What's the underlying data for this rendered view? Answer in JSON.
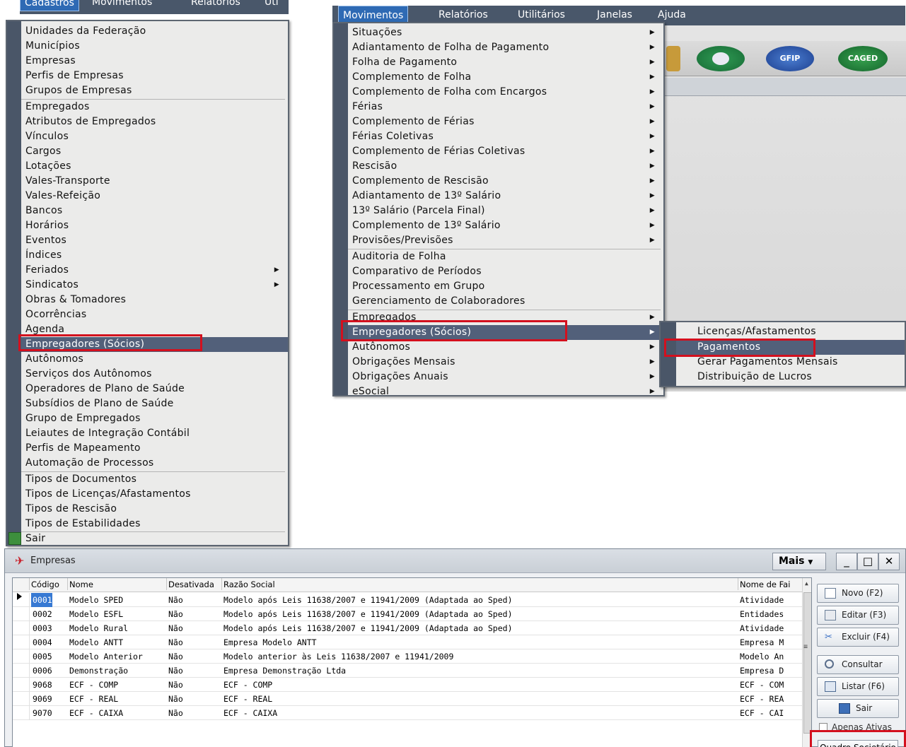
{
  "menubar_left": {
    "items": [
      "Cadastros",
      "Movimentos",
      "Relatórios",
      "Uti"
    ]
  },
  "menubar_right": {
    "items": [
      "Movimentos",
      "Relatórios",
      "Utilitários",
      "Janelas",
      "Ajuda"
    ]
  },
  "menu_cadastros": {
    "items": [
      "Unidades da Federação",
      "Municípios",
      "Empresas",
      "Perfis de Empresas",
      "Grupos de Empresas",
      "Empregados",
      "Atributos de Empregados",
      "Vínculos",
      "Cargos",
      "Lotações",
      "Vales-Transporte",
      "Vales-Refeição",
      "Bancos",
      "Horários",
      "Eventos",
      "Índices",
      "Feriados",
      "Sindicatos",
      "Obras & Tomadores",
      "Ocorrências",
      "Agenda",
      "Empregadores (Sócios)",
      "Autônomos",
      "Serviços dos Autônomos",
      "Operadores de Plano de Saúde",
      "Subsídios de Plano de Saúde",
      "Grupo de Empregados",
      "Leiautes de Integração Contábil",
      "Perfis de Mapeamento",
      "Automação de Processos",
      "Tipos de Documentos",
      "Tipos de Licenças/Afastamentos",
      "Tipos de Rescisão",
      "Tipos de Estabilidades",
      "Sair"
    ]
  },
  "menu_movimentos": {
    "items": [
      "Situações",
      "Adiantamento de Folha de Pagamento",
      "Folha de Pagamento",
      "Complemento de Folha",
      "Complemento de Folha com Encargos",
      "Férias",
      "Complemento de Férias",
      "Férias Coletivas",
      "Complemento de Férias Coletivas",
      "Rescisão",
      "Complemento de Rescisão",
      "Adiantamento de 13º Salário",
      "13º Salário (Parcela Final)",
      "Complemento de 13º Salário",
      "Provisões/Previsões",
      "Auditoria de Folha",
      "Comparativo de Períodos",
      "Processamento em Grupo",
      "Gerenciamento de Colaboradores",
      "Empregados",
      "Empregadores (Sócios)",
      "Autônomos",
      "Obrigações Mensais",
      "Obrigações Anuais",
      "eSocial"
    ]
  },
  "menu_empregadores_sub": {
    "items": [
      "Licenças/Afastamentos",
      "Pagamentos",
      "Gerar Pagamentos Mensais",
      "Distribuição de Lucros"
    ]
  },
  "toolbar_icons": {
    "gfip": "GFIP",
    "caged": "CAGED"
  },
  "window": {
    "title": "Empresas",
    "mais_label": "Mais",
    "columns": [
      "Código",
      "Nome",
      "Desativada",
      "Razão Social",
      "Nome de Fai"
    ],
    "rows": [
      [
        "0001",
        "Modelo SPED",
        "Não",
        "Modelo após Leis 11638/2007 e 11941/2009 (Adaptada ao Sped)",
        "Atividade"
      ],
      [
        "0002",
        "Modelo ESFL",
        "Não",
        "Modelo após Leis 11638/2007 e 11941/2009 (Adaptada ao Sped)",
        "Entidades"
      ],
      [
        "0003",
        "Modelo Rural",
        "Não",
        "Modelo após Leis 11638/2007 e 11941/2009 (Adaptada ao Sped)",
        "Atividade"
      ],
      [
        "0004",
        "Modelo ANTT",
        "Não",
        "Empresa Modelo ANTT",
        "Empresa M"
      ],
      [
        "0005",
        "Modelo Anterior",
        "Não",
        "Modelo anterior às Leis 11638/2007 e 11941/2009",
        "Modelo An"
      ],
      [
        "0006",
        "Demonstração",
        "Não",
        "Empresa Demonstração Ltda",
        "Empresa D"
      ],
      [
        "9068",
        "ECF - COMP",
        "Não",
        "ECF - COMP",
        "ECF - COM"
      ],
      [
        "9069",
        "ECF - REAL",
        "Não",
        "ECF - REAL",
        "ECF - REA"
      ],
      [
        "9070",
        "ECF - CAIXA",
        "Não",
        "ECF - CAIXA",
        "ECF - CAI"
      ]
    ],
    "buttons": {
      "novo": "Novo  (F2)",
      "editar": "Editar  (F3)",
      "excluir": "Excluir (F4)",
      "consultar": "Consultar",
      "listar": "Listar  (F6)",
      "sair": "Sair"
    },
    "apenas_ativas": "Apenas Ativas",
    "quadro_societario": "Quadro Societário"
  },
  "colors": {
    "menu_highlight": "#52607a",
    "menubar": "#49576a",
    "annotation_red": "#d3101e",
    "grid_selection": "#3779d3"
  }
}
